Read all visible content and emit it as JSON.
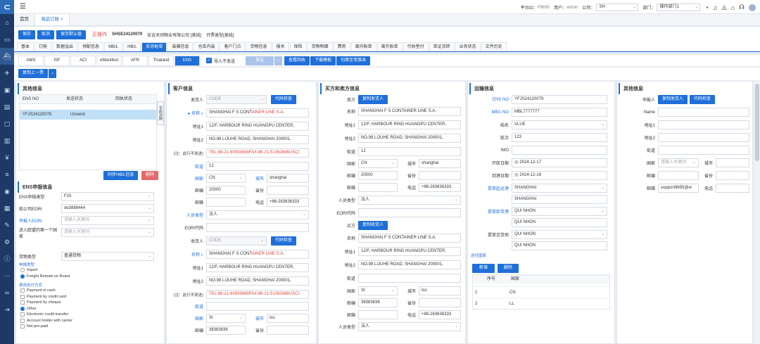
{
  "topbar": {
    "platform_label": "平台ID：",
    "platform_id": "P9695",
    "user_label": "用户：",
    "user": "admin",
    "company_label": "公司：",
    "company": "SH",
    "dept_label": "部门：",
    "dept": "操作部门1"
  },
  "tabs": [
    {
      "label": "首页"
    },
    {
      "label": "海运订舱 ×"
    }
  ],
  "toolbar": {
    "save": "保存",
    "cancel": "取消",
    "save_default": "保存默认值",
    "op_label": "正操作",
    "order_no": "SHSE24120079",
    "company": "安吉天则物业有限公司 [美线]",
    "open_type": "开票类型[美线]"
  },
  "subtabs": [
    "基本",
    "订舱",
    "数据溢出",
    "预配信息",
    "MB/L",
    "HB/L",
    "反恐舱单",
    "装箱信息",
    "仓库内装",
    "客户门点",
    "货物信息",
    "报关",
    "保险",
    "货物明细",
    "费用",
    "离内账单",
    "离外账单",
    "代收垫付",
    "单证流转",
    "业务状态",
    "文件历史"
  ],
  "ens_tabs": [
    "AMS",
    "ISF",
    "ACI",
    "eManifest",
    "AFR",
    "Thailand",
    "ENS"
  ],
  "ens_controls": {
    "import_label": "导入不发送",
    "send": "发送",
    "view_receipt": "查看回执",
    "download_template": "下载模板",
    "switch_old": "切换至老版本",
    "copy_prev": "复制上一票"
  },
  "other_info": {
    "title": "其他信息",
    "cols": [
      "ENS NO",
      "发送状态",
      "回执状态"
    ],
    "rows": [
      {
        "ens_no": "YFJS24120079",
        "send_status": "Unsend",
        "receipt": ""
      }
    ],
    "side_label": "字段对照",
    "sync_btn": "同步HB/L信息",
    "delete_btn": "删除"
  },
  "ens_declare": {
    "title": "ENS申报信息",
    "type_label": "ENS申报类型",
    "type": "F15",
    "eori_label": "船公司EORI",
    "eori": "de3888444",
    "filer_label": "申报人EORI",
    "filer_ph": "请输入关键词",
    "entry_label": "进入欧盟的第一个国家",
    "entry_ph": "请输入关键词",
    "cargo_label": "货物类型",
    "cargo": "普通货物",
    "decl_type_label": "申报类型",
    "decl_types": [
      "Import",
      "Freight Remain on Board"
    ],
    "pay_label": "费用支付方式",
    "pay_methods": [
      "Payment in cash",
      "Payment by credit card",
      "Payment by cheque",
      "Other",
      "Electronic credit transfer",
      "Account holder with carrier",
      "Not pre-paid"
    ]
  },
  "customer": {
    "title": "客户信息",
    "shipper_label": "发货人",
    "shipper_code": "CODE",
    "code_check": "代码检查",
    "name_label": "名称",
    "name_a": "SHANGHAI F S CONT",
    "name_b": "AINER LINE S.A.",
    "addr1_label": "地址1",
    "addr1": "12/F, HARBOUR RING HUANGPU CENTER,",
    "addr2_label": "地址2",
    "addr2": "NO.98 LIJUHE ROAD, SHANGHAI 200001,",
    "note_label": "(注：此行不发送)",
    "note": "TEL:86-21-60933688FAX:86-21-51062688USCI",
    "street_label": "街道",
    "street": "12",
    "country_label": "国家",
    "country": "CN",
    "city_label": "城市",
    "city": "shanghai",
    "post_label": "邮编",
    "post": "20000",
    "province_label": "省份",
    "province": "",
    "mail_label": "邮箱",
    "phone_label": "电话",
    "phone": "+86-263636333",
    "ptype_label": "人员类型",
    "ptype": "法人",
    "eori_label": "EORI代码",
    "consignee_label": "收货人",
    "c_name_a": "SHANGHAI F S CONT",
    "c_name_b": "AINER LINE S.A.",
    "c_addr1": "12/F, HARBOUR RING HUANGPU CENTER,",
    "c_addr2": "NO.98 LIJUHE ROAD, SHANGHAI 200001,",
    "c_note": "TEL:86-21-60933688FAX:86-21-51062688USCI",
    "c_country": "SI",
    "c_city": "lso",
    "c_post": "38383838"
  },
  "buyer_seller": {
    "title": "买方和卖方信息",
    "seller_label": "卖方",
    "copy_shipper": "复制发货人",
    "name": "SHANGHAI F S CONTAINER LINE S.A.",
    "addr1": "12/F, HARBOUR RING HUANGPU CENTER,",
    "addr2": "NO.98 LIJUHE ROAD, SHANGHAI 200001,",
    "street": "12",
    "country": "CN",
    "city": "shanghai",
    "post": "20000",
    "phone": "+86-263636333",
    "ptype": "法人",
    "eori_label": "EORI代码",
    "buyer_label": "买方",
    "copy_consignee": "复制收货人",
    "b_name": "SHANGHAI F S CONTAINER LINE S.A.",
    "b_addr1": "12/F, HARBOUR RING HUANGPU CENTER,",
    "b_addr2": "NO.98 LIJUHE ROAD, SHANGHAI 200001,",
    "b_country": "SI",
    "b_city": "lso",
    "b_post": "38383838",
    "b_phone": "+86-263636333",
    "b_ptype": "法人",
    "l_name": "名称",
    "l_addr1": "地址1",
    "l_addr2": "地址2",
    "l_street": "街道",
    "l_country": "国家",
    "l_city": "城市",
    "l_post": "邮编",
    "l_prov": "省份",
    "l_mail": "邮箱",
    "l_phone": "电话",
    "l_ptype": "人员类型"
  },
  "transport": {
    "title": "运输信息",
    "ens_no_label": "ENS NO",
    "ens_no": "YFJS24120079",
    "mbl_label": "MB/L NO",
    "mbl": "MBL7777777",
    "vessel_label": "船名",
    "vessel": "VLUE",
    "voyage_label": "航次",
    "voyage": "123",
    "imo_label": "IMO",
    "etd_label": "开航日期",
    "etd": "2024-12-17",
    "eta_label": "到港日期",
    "eta": "2024-12-18",
    "pol_label": "提单起运港",
    "pol": "SHANGHAI",
    "pol2": "SHANGHAI",
    "pod_label": "提单卸货港",
    "pod": "QUI NHON",
    "pod2": "QUI NHON",
    "pdel_label": "提单交货地",
    "pdel": "QUI NHON",
    "pdel2": "QUI NHON",
    "via_label": "途径国家",
    "add": "新增",
    "del": "删除",
    "via_cols": [
      "序号",
      "国家"
    ],
    "via_rows": [
      {
        "no": "1",
        "country": "CN"
      },
      {
        "no": "2",
        "country": "LL"
      }
    ]
  },
  "other2": {
    "title": "其他信息",
    "filer_label": "申报人",
    "copy_shipper": "复制发货人",
    "code_check": "代码检查",
    "name_label": "Name",
    "addr1_label": "地址1",
    "addr2_label": "地址2",
    "street_label": "街道",
    "country_label": "国家",
    "country_ph": "请输入关键词",
    "city_label": "城市",
    "post_label": "邮编",
    "prov_label": "省份",
    "mail_label": "邮箱",
    "mail": "support9695@w",
    "phone_label": "电话"
  }
}
